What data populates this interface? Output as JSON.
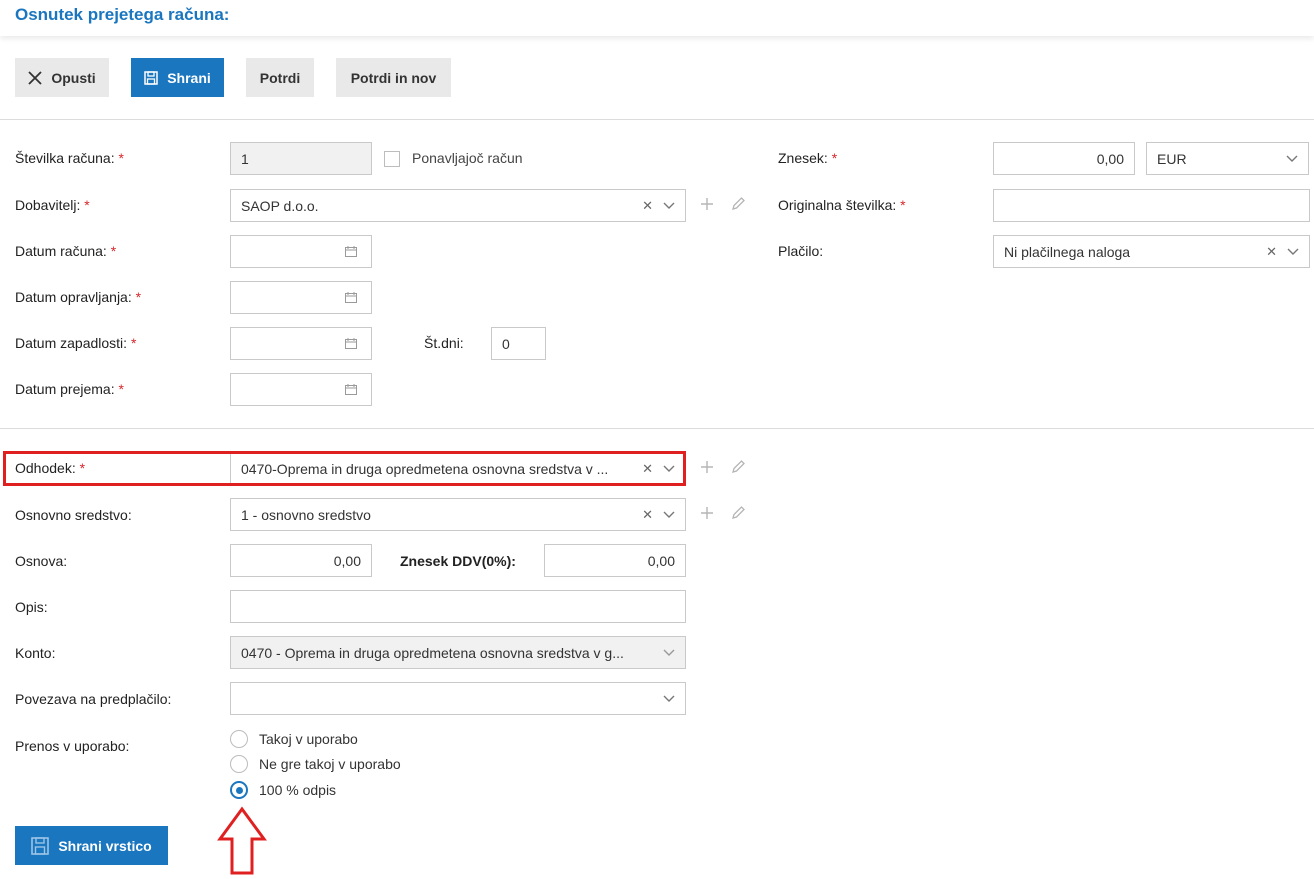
{
  "page": {
    "title": "Osnutek prejetega računa:"
  },
  "toolbar": {
    "discard": "Opusti",
    "save": "Shrani",
    "confirm": "Potrdi",
    "confirm_new": "Potrdi in nov"
  },
  "form": {
    "required_mark": "*",
    "invoice_number": {
      "label": "Številka računa:",
      "value": "1"
    },
    "recurring": {
      "label": "Ponavljajoč račun"
    },
    "supplier": {
      "label": "Dobavitelj:",
      "value": "SAOP d.o.o."
    },
    "invoice_date": {
      "label": "Datum računa:"
    },
    "service_date": {
      "label": "Datum opravljanja:"
    },
    "due_date": {
      "label": "Datum zapadlosti:"
    },
    "days": {
      "label": "Št.dni:",
      "value": "0"
    },
    "receipt_date": {
      "label": "Datum prejema:"
    },
    "amount": {
      "label": "Znesek:",
      "value": "0,00",
      "currency": "EUR"
    },
    "original_number": {
      "label": "Originalna številka:"
    },
    "payment": {
      "label": "Plačilo:",
      "value": "Ni plačilnega naloga"
    }
  },
  "line": {
    "expense": {
      "label": "Odhodek:",
      "value": "0470-Oprema in druga opredmetena osnovna sredstva v ..."
    },
    "fixed_asset": {
      "label": "Osnovno sredstvo:",
      "value": "1 - osnovno sredstvo"
    },
    "base": {
      "label": "Osnova:",
      "value": "0,00"
    },
    "vat": {
      "label": "Znesek DDV(0%):",
      "value": "0,00"
    },
    "description": {
      "label": "Opis:"
    },
    "account": {
      "label": "Konto:",
      "value": "0470 - Oprema in druga opredmetena osnovna sredstva v g..."
    },
    "prepayment": {
      "label": "Povezava na predplačilo:"
    },
    "transfer": {
      "label": "Prenos v uporabo:",
      "options": [
        "Takoj v uporabo",
        "Ne gre takoj v uporabo",
        "100 % odpis"
      ],
      "selected": "100 % odpis"
    },
    "save_line": "Shrani vrstico"
  },
  "colors": {
    "accent": "#1a76bf",
    "annotation": "#e02020",
    "required": "#d9262b"
  }
}
